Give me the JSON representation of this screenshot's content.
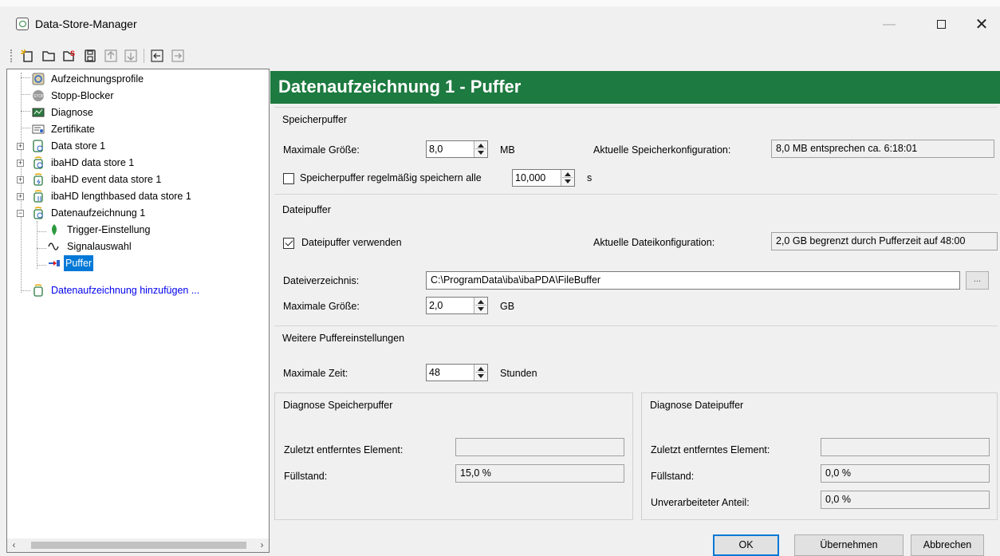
{
  "window": {
    "title": "Data-Store-Manager",
    "minimize_glyph": "—",
    "close_glyph": "✕"
  },
  "toolbar": {
    "icons": [
      "new-datastore-icon",
      "open-folder-icon",
      "add-red-icon",
      "save-icon",
      "move-up-icon",
      "move-down-icon",
      "import-icon",
      "export-icon"
    ]
  },
  "tree": {
    "items": [
      {
        "label": "Aufzeichnungsprofile",
        "icon": "profile-icon"
      },
      {
        "label": "Stopp-Blocker",
        "icon": "stop-icon"
      },
      {
        "label": "Diagnose",
        "icon": "diagnose-icon"
      },
      {
        "label": "Zertifikate",
        "icon": "certificate-icon"
      },
      {
        "label": "Data store 1",
        "icon": "datastore-icon"
      },
      {
        "label": "ibaHD data store 1",
        "icon": "ibahd-icon"
      },
      {
        "label": "ibaHD event data store 1",
        "icon": "ibahd-event-icon"
      },
      {
        "label": "ibaHD lengthbased data store 1",
        "icon": "ibahd-length-icon"
      },
      {
        "label": "Datenaufzeichnung 1",
        "icon": "recording-icon"
      },
      {
        "label": "Trigger-Einstellung",
        "icon": "trigger-icon"
      },
      {
        "label": "Signalauswahl",
        "icon": "signal-icon"
      },
      {
        "label": "Puffer",
        "icon": "buffer-icon"
      },
      {
        "label": "Datenaufzeichnung hinzufügen ...",
        "icon": "add-recording-icon"
      }
    ],
    "expand_plus": "+",
    "expand_minus": "−",
    "scroll_left": "‹",
    "scroll_right": "›"
  },
  "header": {
    "title": "Datenaufzeichnung 1 - Puffer"
  },
  "speicherpuffer": {
    "title": "Speicherpuffer",
    "max_size_label": "Maximale Größe:",
    "max_size_value": "8,0",
    "max_size_unit": "MB",
    "current_config_label": "Aktuelle Speicherkonfiguration:",
    "current_config_value": "8,0 MB entsprechen ca. 6:18:01",
    "periodic_save_label": "Speicherpuffer regelmäßig speichern alle",
    "periodic_save_checked": false,
    "periodic_save_value": "10,000",
    "periodic_save_unit": "s"
  },
  "dateipuffer": {
    "title": "Dateipuffer",
    "use_label": "Dateipuffer verwenden",
    "use_checked": true,
    "current_config_label": "Aktuelle Dateikonfiguration:",
    "current_config_value": "2,0 GB begrenzt durch Pufferzeit auf 48:00",
    "directory_label": "Dateiverzeichnis:",
    "directory_value": "C:\\ProgramData\\iba\\ibaPDA\\FileBuffer",
    "browse_label": "...",
    "max_size_label": "Maximale Größe:",
    "max_size_value": "2,0",
    "max_size_unit": "GB"
  },
  "weitere": {
    "title": "Weitere Puffereinstellungen",
    "max_time_label": "Maximale Zeit:",
    "max_time_value": "48",
    "max_time_unit": "Stunden"
  },
  "diag_speicher": {
    "title": "Diagnose Speicherpuffer",
    "last_removed_label": "Zuletzt entferntes Element:",
    "last_removed_value": "",
    "fill_label": "Füllstand:",
    "fill_value": "15,0 %"
  },
  "diag_datei": {
    "title": "Diagnose Dateipuffer",
    "last_removed_label": "Zuletzt entferntes Element:",
    "last_removed_value": "",
    "fill_label": "Füllstand:",
    "fill_value": "0,0 %",
    "unprocessed_label": "Unverarbeiteter Anteil:",
    "unprocessed_value": "0,0 %"
  },
  "buttons": {
    "ok": "OK",
    "apply": "Übernehmen",
    "cancel": "Abbrechen"
  },
  "colors": {
    "header_bg": "#1d7a40",
    "selection": "#0078d7",
    "link": "#0000ee"
  }
}
